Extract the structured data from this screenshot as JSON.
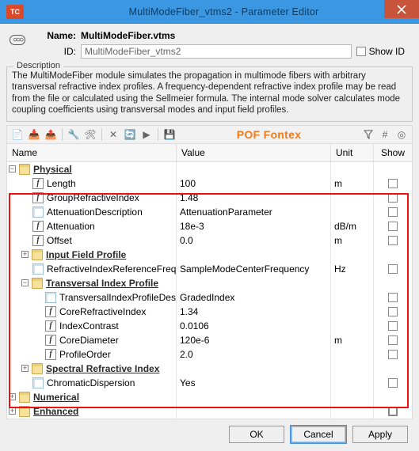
{
  "window": {
    "title": "MultiModeFiber_vtms2 - Parameter Editor"
  },
  "header": {
    "name_label": "Name:",
    "name_value": "MultiModeFiber.vtms",
    "id_label": "ID:",
    "id_value": "MultiModeFiber_vtms2",
    "show_id_label": "Show ID"
  },
  "description": {
    "legend": "Description",
    "text": "The MultiModeFiber module simulates the propagation in multimode fibers with arbitrary transversal refractive index profiles. A frequency-dependent refractive index profile may be read from the file or calculated using the Sellmeier formula. The internal mode solver calculates mode coupling coefficients using transversal modes and input field profiles."
  },
  "overlay_label": "POF Fontex",
  "columns": {
    "name": "Name",
    "value": "Value",
    "unit": "Unit",
    "show": "Show"
  },
  "tree": {
    "physical": "Physical",
    "length": {
      "label": "Length",
      "value": "100",
      "unit": "m"
    },
    "gri": {
      "label": "GroupRefractiveIndex",
      "value": "1.48",
      "unit": ""
    },
    "attdesc": {
      "label": "AttenuationDescription",
      "value": "AttenuationParameter",
      "unit": ""
    },
    "att": {
      "label": "Attenuation",
      "value": "18e-3",
      "unit": "dB/m"
    },
    "offset": {
      "label": "Offset",
      "value": "0.0",
      "unit": "m"
    },
    "ifp": "Input Field Profile",
    "riref": {
      "label": "RefractiveIndexReferenceFreq",
      "value": "SampleModeCenterFrequency",
      "unit": "Hz"
    },
    "tip": "Transversal Index Profile",
    "tipd": {
      "label": "TransversalIndexProfileDesc",
      "value": "GradedIndex",
      "unit": ""
    },
    "cri": {
      "label": "CoreRefractiveIndex",
      "value": "1.34",
      "unit": ""
    },
    "ic": {
      "label": "IndexContrast",
      "value": "0.0106",
      "unit": ""
    },
    "cd": {
      "label": "CoreDiameter",
      "value": "120e-6",
      "unit": "m"
    },
    "po": {
      "label": "ProfileOrder",
      "value": "2.0",
      "unit": ""
    },
    "sri": "Spectral Refractive Index",
    "chd": {
      "label": "ChromaticDispersion",
      "value": "Yes",
      "unit": ""
    },
    "numerical": "Numerical",
    "enhanced": "Enhanced"
  },
  "buttons": {
    "ok": "OK",
    "cancel": "Cancel",
    "apply": "Apply"
  }
}
